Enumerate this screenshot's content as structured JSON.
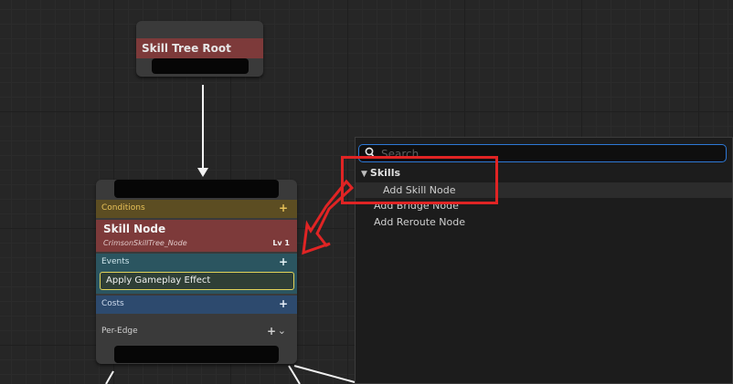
{
  "root_node": {
    "title": "Skill Tree Root"
  },
  "skill_node": {
    "conditions_label": "Conditions",
    "title": "Skill Node",
    "subtitle": "CrimsonSkillTree_Node",
    "level": "Lv 1",
    "events_label": "Events",
    "event_effect": "Apply Gameplay Effect",
    "costs_label": "Costs",
    "per_edge_label": "Per-Edge",
    "plus_symbol": "+",
    "chevron_symbol": "⌄"
  },
  "context_menu": {
    "search_placeholder": "Search",
    "category": "Skills",
    "category_arrow": "▼",
    "items": [
      "Add Skill Node",
      "Add Bridge Node",
      "Add Reroute Node"
    ]
  },
  "colors": {
    "title_bar": "#7d3a3a",
    "conditions": "#5c4d22",
    "events": "#2b5560",
    "costs": "#2d4a6e",
    "highlight": "#e02424",
    "search_border": "#2d78d6"
  }
}
